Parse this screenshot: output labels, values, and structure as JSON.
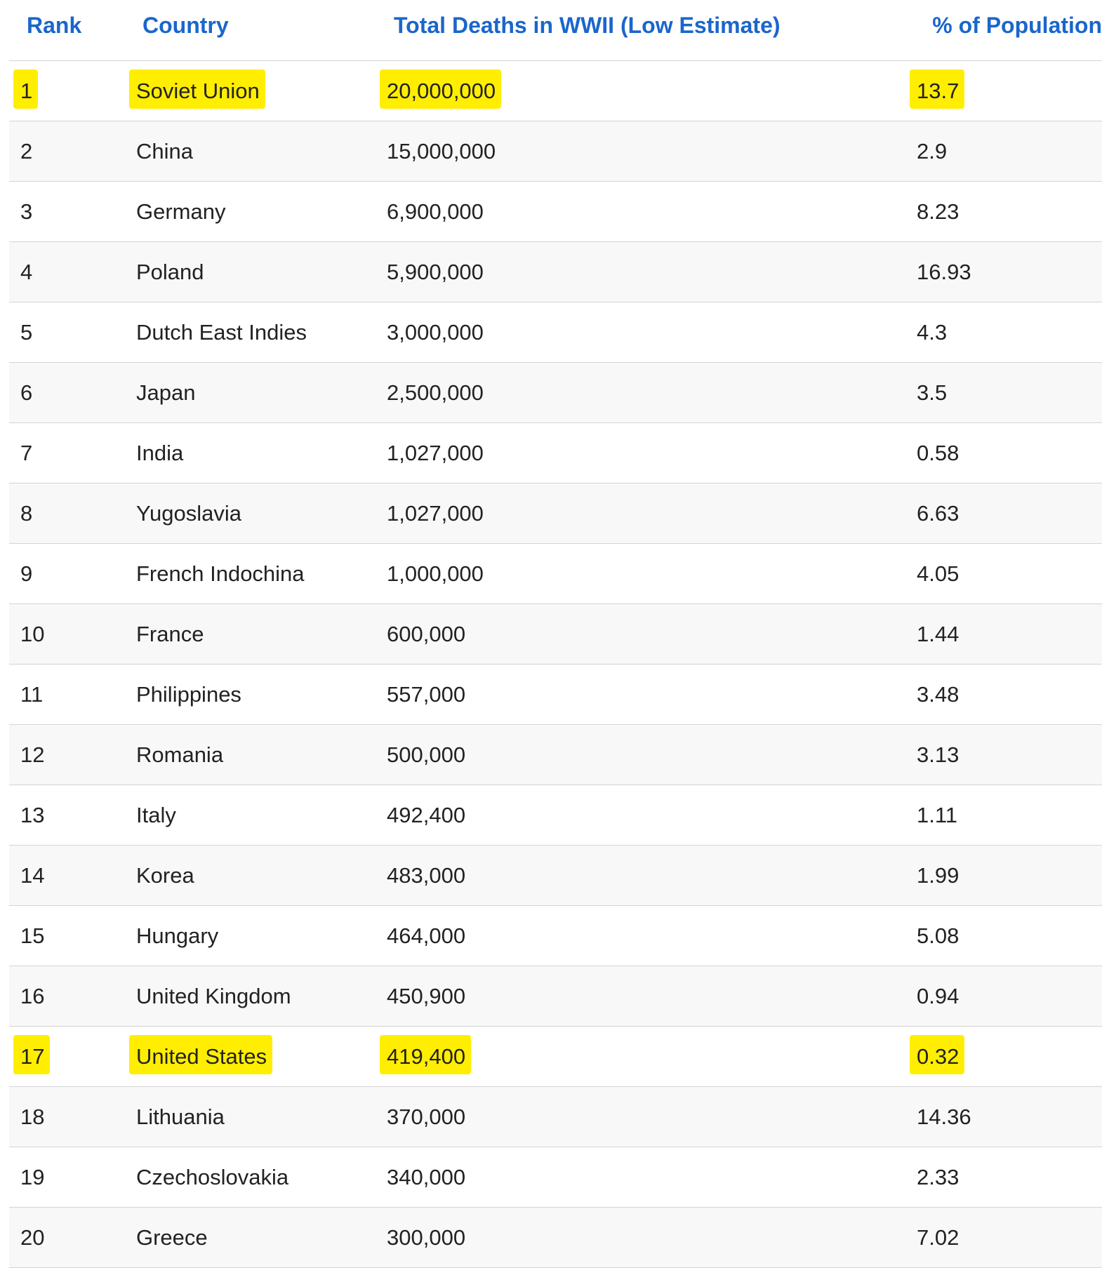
{
  "header": {
    "rank": "Rank",
    "country": "Country",
    "deaths": "Total Deaths in WWII (Low Estimate)",
    "pct": "% of Population"
  },
  "highlight_color": "#ffee00",
  "link_color": "#1a66cc",
  "rows": [
    {
      "rank": "1",
      "country": "Soviet Union",
      "deaths": "20,000,000",
      "pct": "13.7",
      "highlighted": true
    },
    {
      "rank": "2",
      "country": "China",
      "deaths": "15,000,000",
      "pct": "2.9",
      "highlighted": false
    },
    {
      "rank": "3",
      "country": "Germany",
      "deaths": "6,900,000",
      "pct": "8.23",
      "highlighted": false
    },
    {
      "rank": "4",
      "country": "Poland",
      "deaths": "5,900,000",
      "pct": "16.93",
      "highlighted": false
    },
    {
      "rank": "5",
      "country": "Dutch East Indies",
      "deaths": "3,000,000",
      "pct": "4.3",
      "highlighted": false
    },
    {
      "rank": "6",
      "country": "Japan",
      "deaths": "2,500,000",
      "pct": "3.5",
      "highlighted": false
    },
    {
      "rank": "7",
      "country": "India",
      "deaths": "1,027,000",
      "pct": "0.58",
      "highlighted": false
    },
    {
      "rank": "8",
      "country": "Yugoslavia",
      "deaths": "1,027,000",
      "pct": "6.63",
      "highlighted": false
    },
    {
      "rank": "9",
      "country": "French Indochina",
      "deaths": "1,000,000",
      "pct": "4.05",
      "highlighted": false
    },
    {
      "rank": "10",
      "country": "France",
      "deaths": "600,000",
      "pct": "1.44",
      "highlighted": false
    },
    {
      "rank": "11",
      "country": "Philippines",
      "deaths": "557,000",
      "pct": "3.48",
      "highlighted": false
    },
    {
      "rank": "12",
      "country": "Romania",
      "deaths": "500,000",
      "pct": "3.13",
      "highlighted": false
    },
    {
      "rank": "13",
      "country": "Italy",
      "deaths": "492,400",
      "pct": "1.11",
      "highlighted": false
    },
    {
      "rank": "14",
      "country": "Korea",
      "deaths": "483,000",
      "pct": "1.99",
      "highlighted": false
    },
    {
      "rank": "15",
      "country": "Hungary",
      "deaths": "464,000",
      "pct": "5.08",
      "highlighted": false
    },
    {
      "rank": "16",
      "country": "United Kingdom",
      "deaths": "450,900",
      "pct": "0.94",
      "highlighted": false
    },
    {
      "rank": "17",
      "country": "United States",
      "deaths": "419,400",
      "pct": "0.32",
      "highlighted": true
    },
    {
      "rank": "18",
      "country": "Lithuania",
      "deaths": "370,000",
      "pct": "14.36",
      "highlighted": false
    },
    {
      "rank": "19",
      "country": "Czechoslovakia",
      "deaths": "340,000",
      "pct": "2.33",
      "highlighted": false
    },
    {
      "rank": "20",
      "country": "Greece",
      "deaths": "300,000",
      "pct": "7.02",
      "highlighted": false
    }
  ]
}
